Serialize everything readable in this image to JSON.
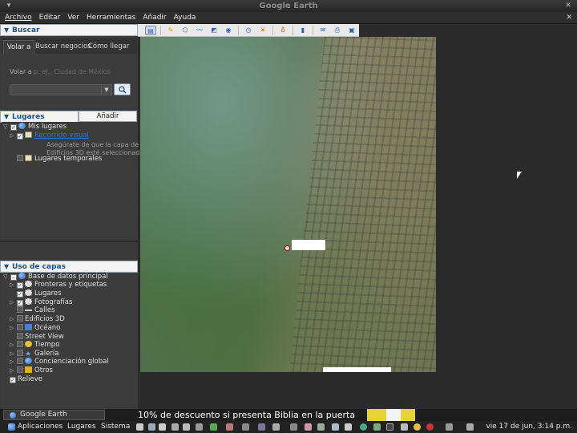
{
  "window": {
    "title": "Google Earth",
    "min_label": "▾",
    "close_label": "✕"
  },
  "menubar": {
    "items": [
      "Archivo",
      "Editar",
      "Ver",
      "Herramientas",
      "Añadir",
      "Ayuda"
    ],
    "close_label": "✕"
  },
  "search": {
    "header": "Buscar",
    "tabs": [
      "Volar a",
      "Buscar negocios",
      "Cómo llegar"
    ],
    "fly_label": "Volar a",
    "fly_placeholder": "p. ej., Ciudad de México",
    "search_button_icon": "magnifier-icon"
  },
  "places": {
    "header": "Lugares",
    "add_content": "Añadir contenido",
    "my_places": "Mis lugares",
    "tour_link": "Recorrido visual",
    "tour_note_1": "Asegúrate de que la capa de",
    "tour_note_2": "Edificios 3D esté seleccionada",
    "temp_places": "Lugares temporales"
  },
  "layers": {
    "header": "Uso de capas",
    "items": [
      "Base de datos principal",
      "Fronteras y etiquetas",
      "Lugares",
      "Fotografías",
      "Calles",
      "Edificios 3D",
      "Océano",
      "Street View",
      "Tiempo",
      "Galería",
      "Concienciación global",
      "Otros",
      "Relieve"
    ]
  },
  "taskbar": {
    "window_item": "Google Earth",
    "ticker": "10% de descuento si presenta Biblia en la puerta",
    "menus": [
      "Aplicaciones",
      "Lugares",
      "Sistema"
    ],
    "clock": "vie 17 de jun,   3:14 p.m."
  },
  "colors": {
    "accent": "#1f4f8f",
    "link": "#3a6ed8",
    "panel": "#3c3c3c"
  }
}
